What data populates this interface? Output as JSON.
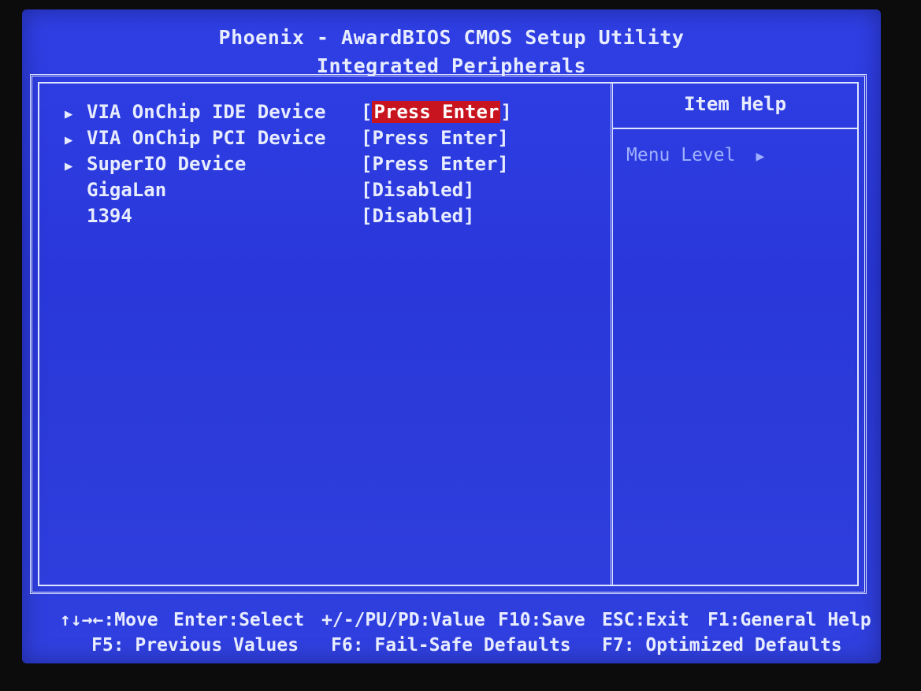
{
  "header": {
    "title": "Phoenix - AwardBIOS CMOS Setup Utility",
    "subtitle": "Integrated Peripherals"
  },
  "items": [
    {
      "label": "VIA OnChip IDE Device",
      "value": "Press Enter",
      "submenu": true,
      "selected": true
    },
    {
      "label": "VIA OnChip PCI Device",
      "value": "Press Enter",
      "submenu": true,
      "selected": false
    },
    {
      "label": "SuperIO Device",
      "value": "Press Enter",
      "submenu": true,
      "selected": false
    },
    {
      "label": "GigaLan",
      "value": "Disabled",
      "submenu": false,
      "selected": false
    },
    {
      "label": "1394",
      "value": "Disabled",
      "submenu": false,
      "selected": false
    }
  ],
  "help_panel": {
    "title": "Item Help",
    "menu_level_label": "Menu Level",
    "menu_level_icon": "right-triangle-icon"
  },
  "footer": {
    "line1": {
      "move": "↑↓→←:Move",
      "select": "Enter:Select",
      "value": "+/-/PU/PD:Value",
      "save": "F10:Save",
      "exit": "ESC:Exit",
      "help": "F1:General Help"
    },
    "line2": {
      "previous": "F5: Previous Values",
      "failsafe": "F6: Fail-Safe Defaults",
      "optimized": "F7: Optimized Defaults"
    }
  },
  "colors": {
    "background": "#2f3fe4",
    "text": "#e8ecff",
    "highlight": "#c8141e",
    "help_text": "#9fb0ff"
  }
}
